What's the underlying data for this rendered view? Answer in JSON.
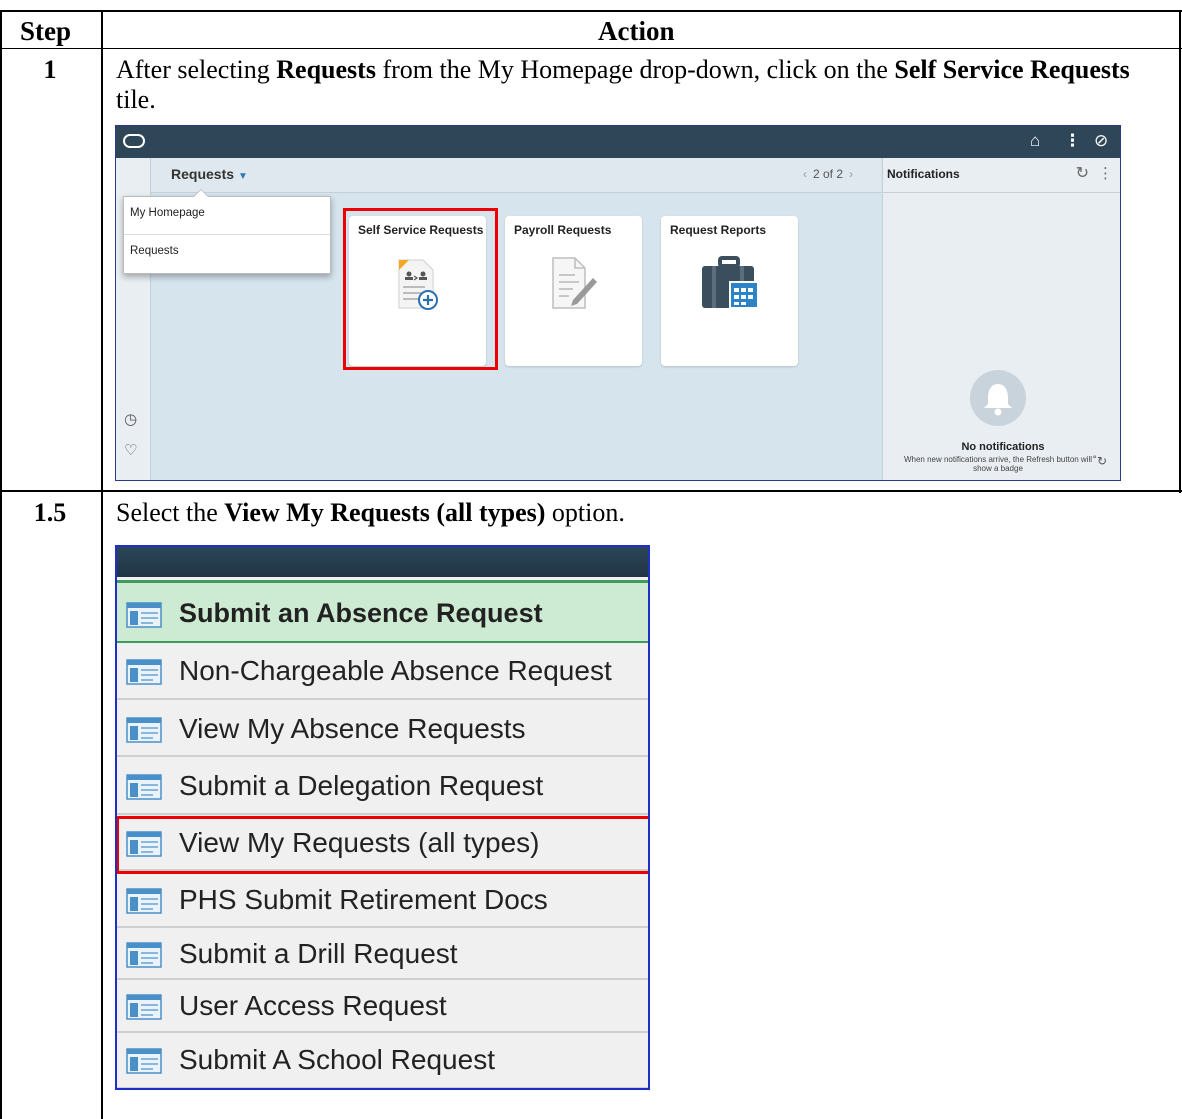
{
  "table": {
    "header_step": "Step",
    "header_action": "Action"
  },
  "rows": [
    {
      "step": "1",
      "text_before": "After selecting ",
      "bold1": "Requests",
      "text_mid": " from the My Homepage drop-down, click on the ",
      "bold2": "Self Service Requests",
      "text_after": " tile."
    },
    {
      "step": "1.5",
      "text_before": "Select the ",
      "bold1": "View My Requests (all types)",
      "text_after": " option."
    }
  ],
  "screenshot1": {
    "header_button": "Requests",
    "pager_text": "2 of 2",
    "dropdown_items": [
      "My Homepage",
      "Requests"
    ],
    "tiles": [
      "Self Service Requests",
      "Payroll Requests",
      "Request Reports"
    ],
    "notifications_title": "Notifications",
    "no_notifications": "No notifications",
    "notifications_hint": "When new notifications arrive, the Refresh button will show a badge"
  },
  "screenshot2": {
    "menu_items": [
      "Submit an Absence Request",
      "Non-Chargeable Absence Request",
      "View My Absence Requests",
      "Submit a Delegation Request",
      "View My Requests (all types)",
      "PHS Submit Retirement Docs",
      "Submit a Drill Request",
      "User Access Request",
      "Submit A School Request"
    ]
  },
  "colors": {
    "highlight_red": "#ee0000",
    "header_bar": "#2f4558",
    "selected_row_green": "#cdebd3"
  }
}
